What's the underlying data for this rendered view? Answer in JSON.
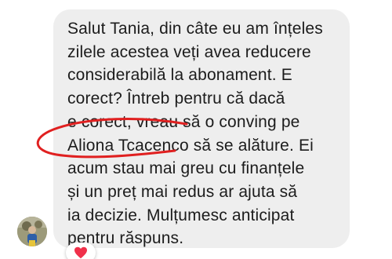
{
  "message": {
    "lines": [
      "Salut Tania, din câte eu am înțeles",
      "zilele acestea veți avea reducere",
      "considerabilă la abonament. E",
      "corect? Întreb pentru că dacă",
      "e corect, vreau să o conving pe",
      "Aliona Tcacenco să se alăture. Ei",
      "acum stau mai greu cu finanțele",
      "și un preț mai redus ar ajuta să",
      "ia decizie. Mulțumesc anticipat",
      "pentru răspuns."
    ]
  },
  "colors": {
    "bubble": "#eeeeee",
    "text": "#1c1c1c",
    "annotation": "#e02020",
    "reaction": "#f0304a"
  },
  "icons": {
    "avatar": "user-avatar",
    "reaction": "heart-icon"
  }
}
